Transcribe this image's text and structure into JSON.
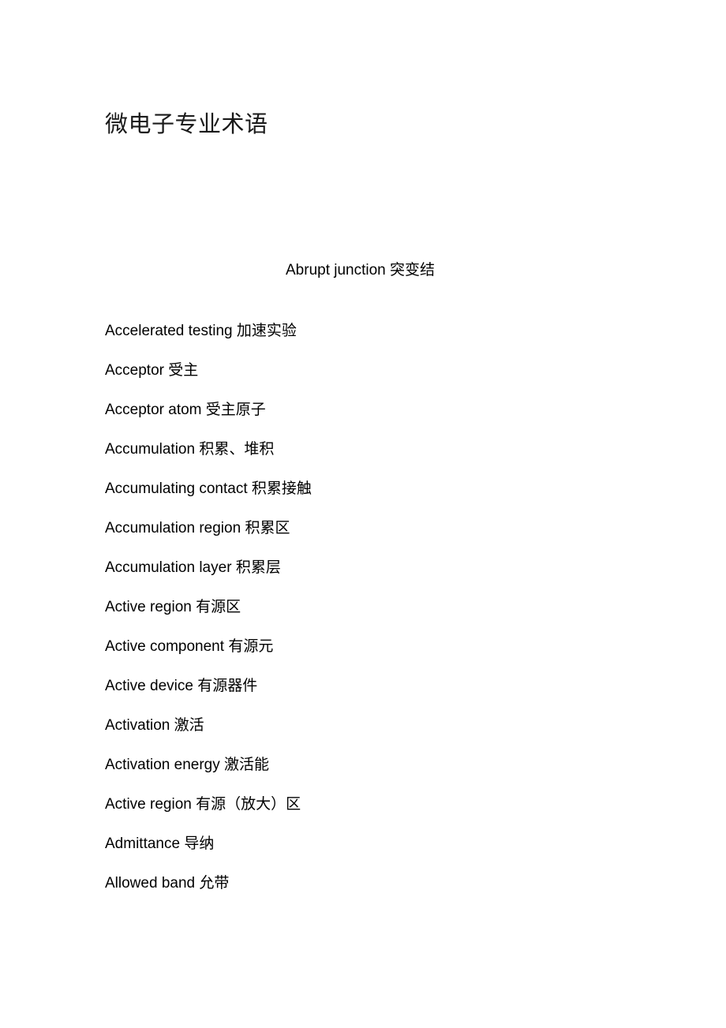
{
  "document": {
    "title": "微电子专业术语",
    "lead_entry": {
      "text": "Abrupt junction 突变结",
      "english": "Abrupt junction",
      "chinese": "突变结"
    },
    "entries": [
      {
        "english": "Accelerated testing",
        "chinese": "加速实验",
        "text": "Accelerated testing 加速实验"
      },
      {
        "english": "Acceptor",
        "chinese": "受主",
        "text": "Acceptor 受主"
      },
      {
        "english": "Acceptor atom",
        "chinese": "受主原子",
        "text": "Acceptor atom 受主原子"
      },
      {
        "english": "Accumulation",
        "chinese": "积累、堆积",
        "text": "Accumulation 积累、堆积"
      },
      {
        "english": "Accumulating contact",
        "chinese": "积累接触",
        "text": "Accumulating contact 积累接触"
      },
      {
        "english": "Accumulation region",
        "chinese": "积累区",
        "text": "Accumulation region 积累区"
      },
      {
        "english": "Accumulation layer",
        "chinese": "积累层",
        "text": "Accumulation layer 积累层"
      },
      {
        "english": "Active region",
        "chinese": "有源区",
        "text": "Active region 有源区"
      },
      {
        "english": "Active component",
        "chinese": "有源元",
        "text": "Active component 有源元"
      },
      {
        "english": "Active device",
        "chinese": "有源器件",
        "text": "Active device 有源器件"
      },
      {
        "english": "Activation",
        "chinese": "激活",
        "text": "Activation 激活"
      },
      {
        "english": "Activation energy",
        "chinese": "激活能",
        "text": "Activation energy 激活能"
      },
      {
        "english": "Active region",
        "chinese": "有源（放大）区",
        "text": "Active region 有源（放大）区"
      },
      {
        "english": "Admittance",
        "chinese": "导纳",
        "text": "Admittance 导纳"
      },
      {
        "english": "Allowed band",
        "chinese": "允带",
        "text": "Allowed band 允带"
      }
    ]
  }
}
